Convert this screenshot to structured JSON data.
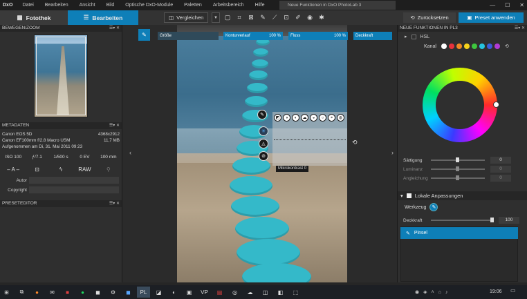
{
  "app": {
    "logo": "DxO",
    "document_title": "Neue Funktionen in DxO PhotoLab 3",
    "menu": [
      "Datei",
      "Bearbeiten",
      "Ansicht",
      "Bild",
      "Optische DxO-Module",
      "Paletten",
      "Arbeitsbereich",
      "Hilfe"
    ]
  },
  "toolbar": {
    "tab_library": "Fotothek",
    "tab_edit": "Bearbeiten",
    "compare_label": "Vergleichen",
    "reset_label": "Zurücksetzen",
    "apply_preset_label": "Preset anwenden",
    "accent_color": "#0e7fb8"
  },
  "left_panel": {
    "navigator_title": "BEWEGEN/ZOOM",
    "metadata_title": "METADATEN",
    "camera": "Canon EOS 5D",
    "resolution": "4368x2912",
    "lens": "Canon EF100mm f/2.8 Macro USM",
    "filesize": "11,7 MB",
    "taken": "Aufgenommen am Di, 31. Mai 2011 09:23",
    "exif": {
      "iso": "ISO 100",
      "aperture": "ƒ/7.1",
      "shutter": "1/500 s",
      "ev": "0 EV",
      "focal": "100 mm"
    },
    "raw_label": "RAW",
    "exposure_label": "– A –",
    "author_label": "Autor",
    "copyright_label": "Copyright",
    "preset_editor_title": "PRESETEDITOR"
  },
  "mask_toolbar": {
    "size_label": "Größe",
    "feather_label": "Konturverlauf",
    "feather_value": "100 %",
    "flow_label": "Fluss",
    "flow_value": "100 %",
    "opacity_label": "Deckkraft"
  },
  "overlay": {
    "tooltip_label": "Mikrokontrast",
    "tooltip_value": "0"
  },
  "right_panel": {
    "title": "NEUE FUNKTIONEN IN PL3",
    "hsl_label": "HSL",
    "channel_label": "Kanal",
    "channel_colors": [
      "#ffffff",
      "#e8323c",
      "#f08a24",
      "#f5d21c",
      "#3ec63e",
      "#26c3e0",
      "#3b5bdb",
      "#b13bd6"
    ],
    "saturation_label": "Sättigung",
    "saturation_value": "0",
    "luminance_label": "Luminanz",
    "luminance_value": "0",
    "uniformity_label": "Angleichung",
    "uniformity_value": "0",
    "local_adjust_label": "Lokale Anpassungen",
    "tool_label": "Werkzeug",
    "opacity_label": "Deckkraft",
    "opacity_value": "100",
    "brush_item_label": "Pinsel"
  },
  "taskbar": {
    "clock": "19:06"
  }
}
